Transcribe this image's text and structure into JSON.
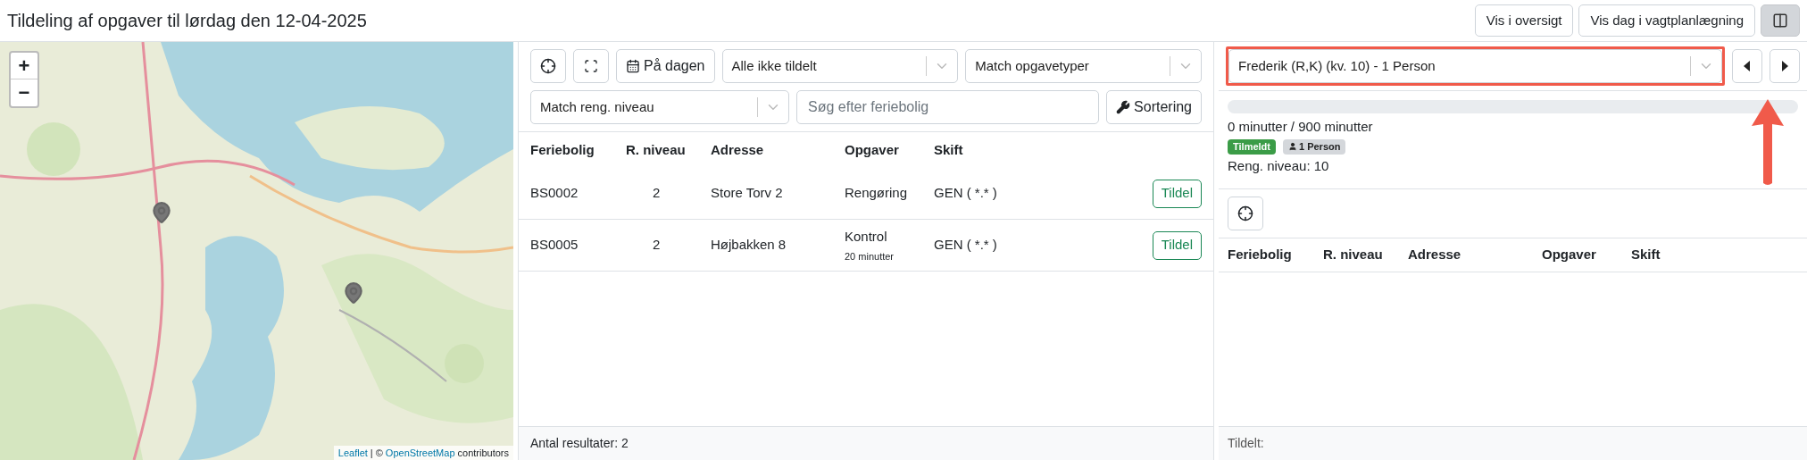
{
  "header": {
    "title": "Tildeling af opgaver til lørdag den 12-04-2025",
    "buttons": [
      "Vis i oversigt",
      "Vis dag i vagtplanlægning"
    ],
    "layout_toggle": {
      "selected": true
    }
  },
  "map": {
    "zoom_in": "+",
    "zoom_out": "−",
    "attribution": {
      "link_1": "Leaflet",
      "separator": "| ©",
      "link_2": "OpenStreetMap",
      "suffix": "contributors"
    }
  },
  "tasks_panel": {
    "day_button": "På dagen",
    "filter_assigned": "Alle ikke tildelt",
    "filter_types": "Match opgavetyper",
    "filter_level": "Match reng. niveau",
    "search": {
      "placeholder": "Søg efter feriebolig"
    },
    "sort_button": "Sortering",
    "columns": [
      "Feriebolig",
      "R. niveau",
      "Adresse",
      "Opgaver",
      "Skift"
    ],
    "rows": [
      {
        "house": "BS0002",
        "level": "2",
        "address": "Store Torv 2",
        "task": "Rengøring",
        "shift": "GEN ( *.* )",
        "action": "Tildel"
      },
      {
        "house": "BS0005",
        "level": "2",
        "address": "Højbakken 8",
        "task": "Kontrol",
        "duration": "20 minutter",
        "shift": "GEN ( *.* )",
        "action": "Tildel"
      }
    ],
    "footer": "Antal resultater: 2"
  },
  "staff_panel": {
    "select": "Frederik (R,K) (kv. 10) - 1 Person",
    "workload": {
      "level": 0,
      "reading": "0 minutter / 900 minutter"
    },
    "badges": [
      {
        "kind": "status",
        "label": "Tilmeldt",
        "color": "#3b9c47"
      },
      {
        "kind": "person",
        "label": "1 Person",
        "color": "#d4d7db"
      }
    ],
    "level_text": "Reng. niveau: 10",
    "columns": [
      "Feriebolig",
      "R. niveau",
      "Adresse",
      "Opgaver",
      "Skift"
    ],
    "footer": "Tildelt:"
  }
}
